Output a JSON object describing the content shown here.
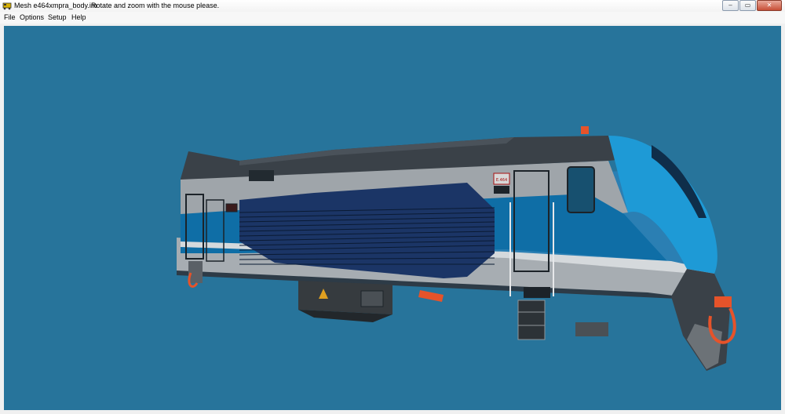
{
  "window": {
    "title": "Mesh e464xmpra_body.im",
    "hint": "Rotate and zoom with the mouse please.",
    "buttons": {
      "minimize": "–",
      "maximize": "▭",
      "close": "✕"
    }
  },
  "menu": {
    "items": [
      {
        "label": "File"
      },
      {
        "label": "Options"
      },
      {
        "label": "Setup"
      },
      {
        "label": "Help"
      }
    ]
  },
  "viewport": {
    "background": "#27749b",
    "model": "locomotive-body-mesh",
    "colors": {
      "roof": "#3a4148",
      "body_gray": "#aeb3b7",
      "stripe_blue": "#0f6ea6",
      "panel_navy": "#1b3566",
      "nose_cyan": "#1e9ad6",
      "accent_orange": "#e6532a"
    },
    "plate_text": "E.464"
  }
}
